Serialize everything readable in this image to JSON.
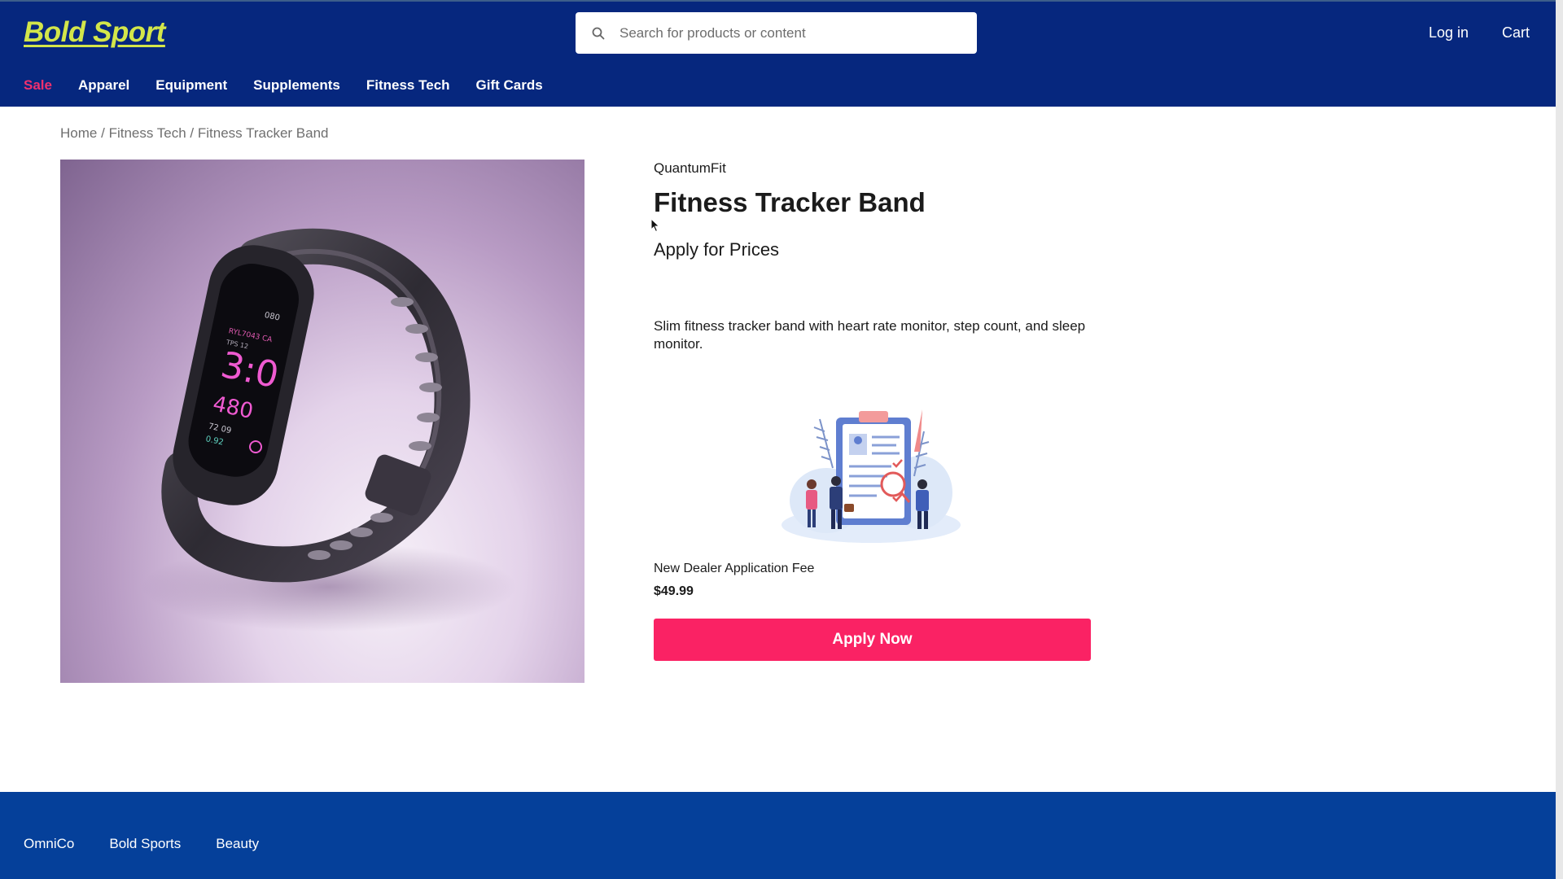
{
  "header": {
    "logo": "Bold Sport",
    "search_placeholder": "Search for products or content",
    "login": "Log in",
    "cart": "Cart"
  },
  "nav": {
    "items": [
      "Sale",
      "Apparel",
      "Equipment",
      "Supplements",
      "Fitness Tech",
      "Gift Cards"
    ]
  },
  "breadcrumb": {
    "home": "Home",
    "category": "Fitness Tech",
    "current": "Fitness Tracker Band",
    "sep": "/"
  },
  "product": {
    "brand": "QuantumFit",
    "title": "Fitness Tracker Band",
    "price_label": "Apply for Prices",
    "description": "Slim fitness tracker band with heart rate monitor, step count, and sleep monitor.",
    "screen": {
      "time": "3:0",
      "steps": "480",
      "small_top": "080",
      "line1": "RYL7043 CA",
      "line2": "TPS 12",
      "line3": "72 09",
      "line4": "0.92"
    }
  },
  "application": {
    "fee_name": "New Dealer Application Fee",
    "fee_price": "$49.99",
    "button": "Apply Now"
  },
  "footer": {
    "links": [
      "OmniCo",
      "Bold Sports",
      "Beauty"
    ]
  },
  "colors": {
    "header_bg": "#06277e",
    "footer_bg": "#05409a",
    "accent": "#fa2264",
    "logo": "#d3e64a",
    "sale": "#f0306e"
  }
}
